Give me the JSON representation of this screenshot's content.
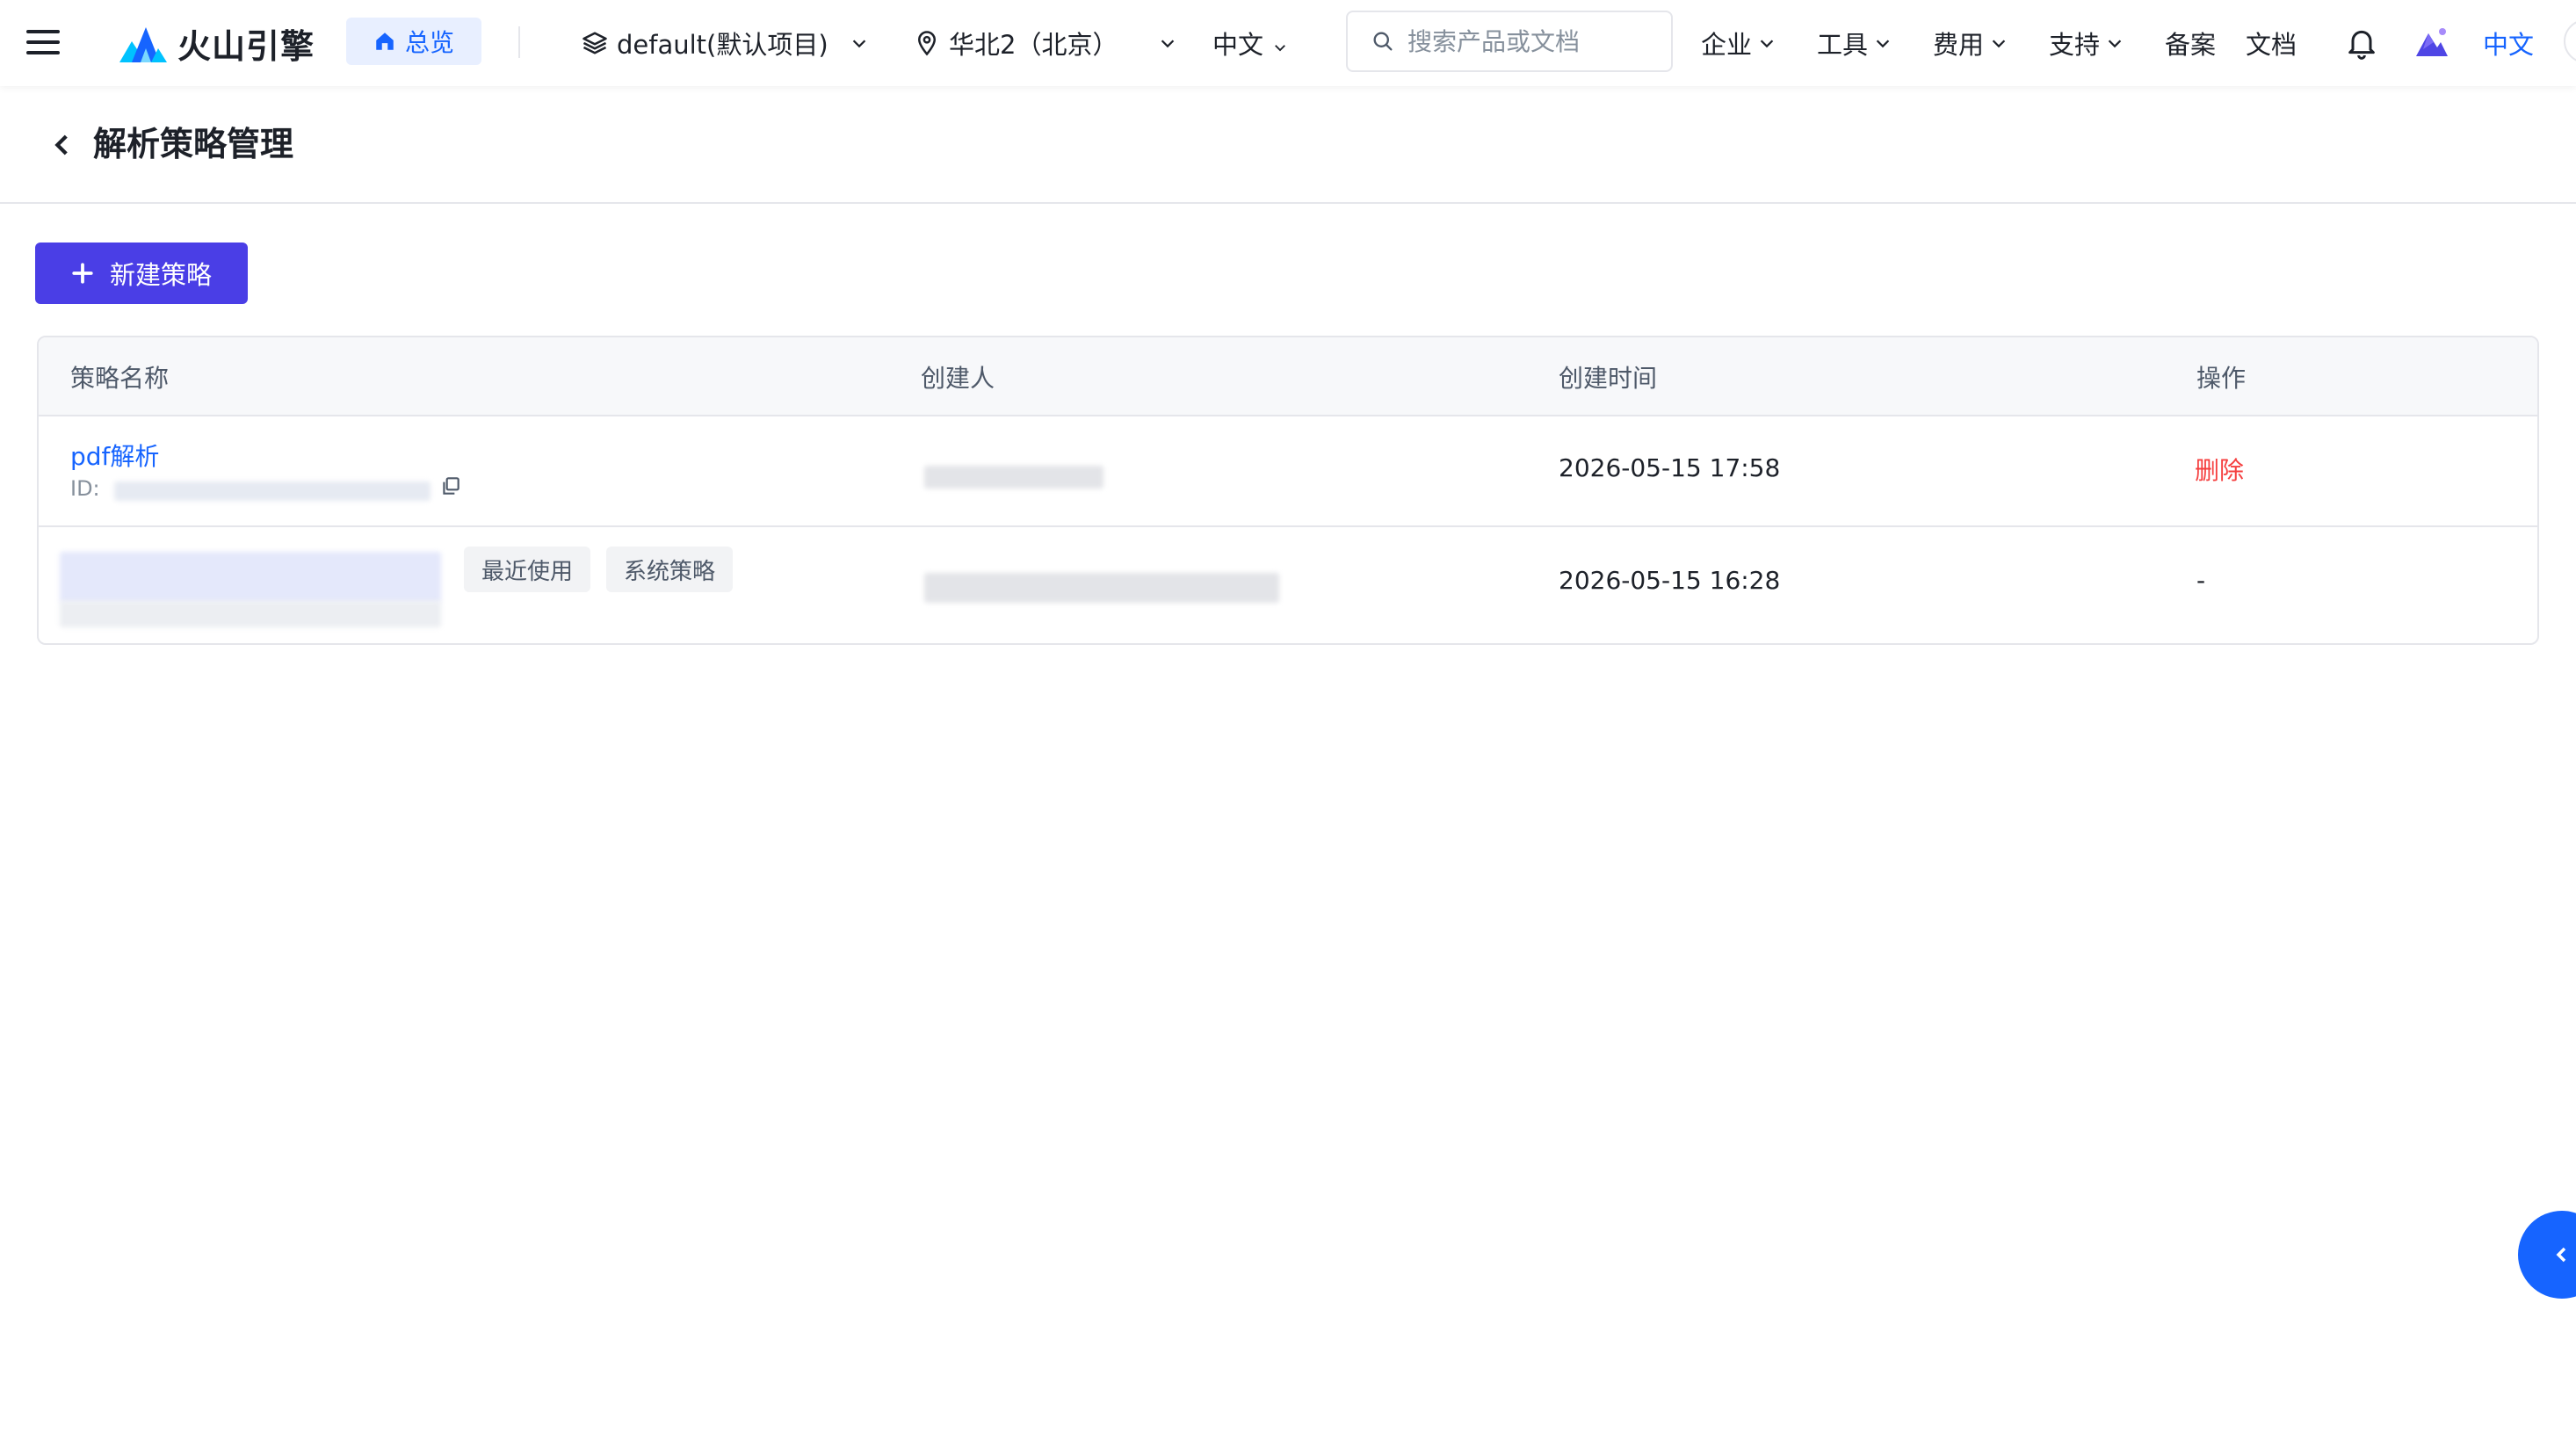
{
  "nav": {
    "logo_text": "火山引擎",
    "home_label": "总览",
    "project_label": "default(默认项目)",
    "region_label": "华北2（北京）",
    "language_label": "中文",
    "search_placeholder": "搜索产品或文档",
    "menu": [
      {
        "label": "企业"
      },
      {
        "label": "工具"
      },
      {
        "label": "费用"
      },
      {
        "label": "支持"
      },
      {
        "label": "备案"
      },
      {
        "label": "文档"
      }
    ],
    "language_right": "中文"
  },
  "page": {
    "title": "解析策略管理",
    "new_button_label": "新建策略"
  },
  "table": {
    "columns": [
      "策略名称",
      "创建人",
      "创建时间",
      "操作"
    ],
    "rows": [
      {
        "name": "pdf解析",
        "id_label": "ID:",
        "created_at": "2026-05-15 17:58",
        "action": "删除"
      },
      {
        "tags": [
          "最近使用",
          "系统策略"
        ],
        "created_at": "2026-05-15 16:28",
        "action": "-"
      }
    ]
  },
  "colors": {
    "primary": "#4a3ee6",
    "link": "#1664ff",
    "danger": "#f53f3f"
  }
}
